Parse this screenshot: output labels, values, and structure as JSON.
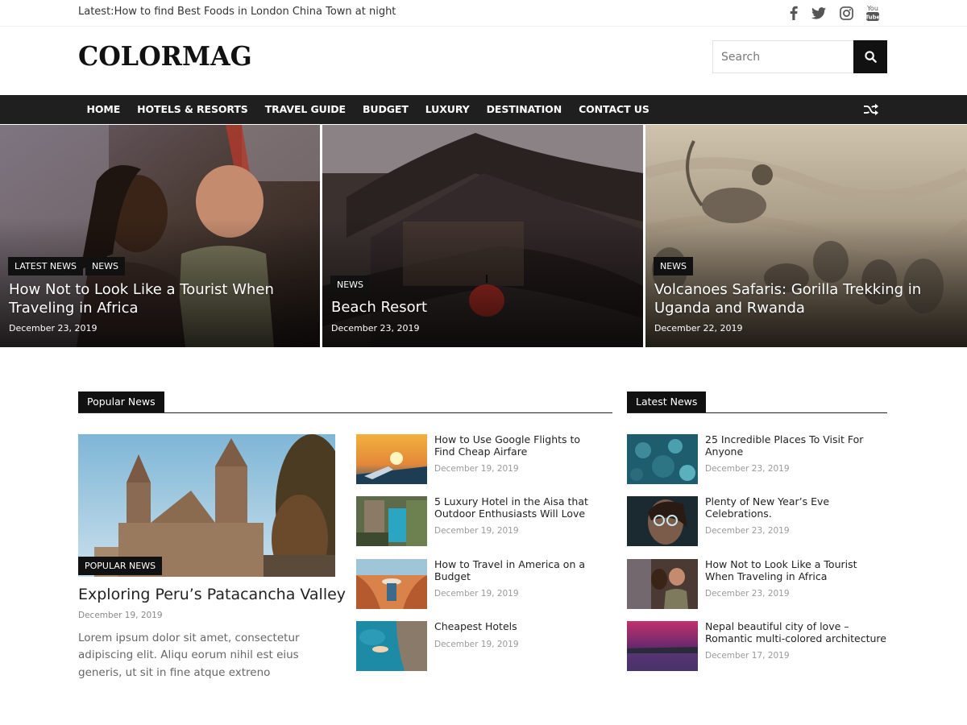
{
  "topbar": {
    "latest_label": "Latest:",
    "latest_headline": "How to find Best Foods in London China Town at night",
    "social_icons": [
      "facebook-icon",
      "twitter-icon",
      "instagram-icon",
      "youtube-icon"
    ]
  },
  "header": {
    "logo": "COLORMAG",
    "search_placeholder": "Search"
  },
  "nav": {
    "items": [
      "HOME",
      "HOTELS & RESORTS",
      "TRAVEL GUIDE",
      "BUDGET",
      "LUXURY",
      "DESTINATION",
      "CONTACT US"
    ],
    "shuffle_icon": "shuffle-icon"
  },
  "hero": [
    {
      "badges": [
        "LATEST NEWS",
        "NEWS"
      ],
      "title": "How Not to Look Like a Tourist When Traveling in Africa",
      "date": "December 23, 2019"
    },
    {
      "badges": [
        "NEWS"
      ],
      "title": "Beach Resort",
      "date": "December 23, 2019"
    },
    {
      "badges": [
        "NEWS"
      ],
      "title": "Volcanoes Safaris: Gorilla Trekking in Uganda and Rwanda",
      "date": "December 22, 2019"
    }
  ],
  "popular": {
    "heading": "Popular News",
    "featured": {
      "badge": "POPULAR NEWS",
      "title": "Exploring Peru’s Patacancha Valley",
      "date": "December 19, 2019",
      "excerpt": "Lorem ipsum dolor sit amet, consectetur adipiscing elit. Aliqu eorum nihil est eius generis, ut sit in fine atque extreno"
    },
    "items": [
      {
        "title": "How to Use Google Flights to Find Cheap Airfare",
        "date": "December 19, 2019"
      },
      {
        "title": "5 Luxury Hotel in the Aisa that Outdoor Enthusiasts Will Love",
        "date": "December 19, 2019"
      },
      {
        "title": "How to Travel in America on a Budget",
        "date": "December 19, 2019"
      },
      {
        "title": "Cheapest Hotels",
        "date": "December 19, 2019"
      }
    ]
  },
  "latest": {
    "heading": "Latest News",
    "items": [
      {
        "title": "25 Incredible Places To Visit For Anyone",
        "date": "December 23, 2019"
      },
      {
        "title": "Plenty of New Year’s Eve Celebrations.",
        "date": "December 23, 2019"
      },
      {
        "title": "How Not to Look Like a Tourist When Traveling in Africa",
        "date": "December 23, 2019"
      },
      {
        "title": "Nepal beautiful city of love – Romantic multi-colored architecture",
        "date": "December 17, 2019"
      }
    ]
  }
}
